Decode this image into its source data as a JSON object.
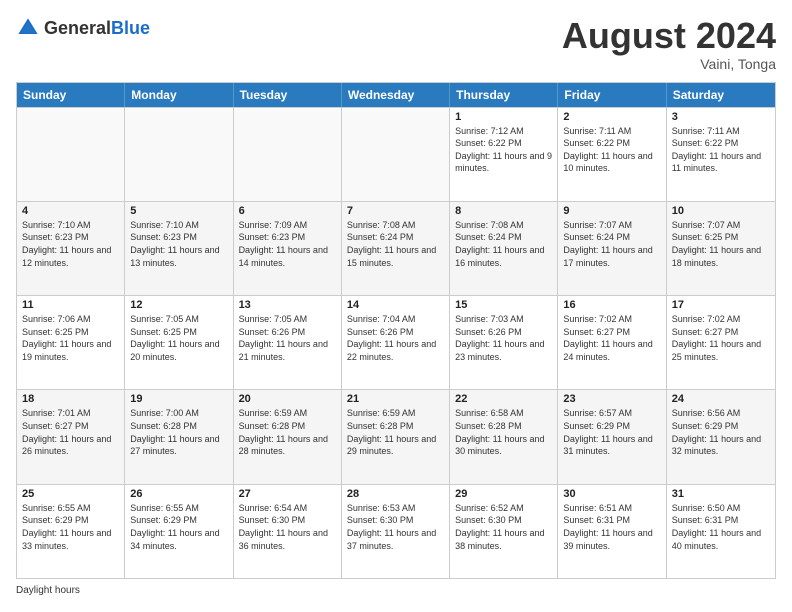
{
  "header": {
    "logo_general": "General",
    "logo_blue": "Blue",
    "month_title": "August 2024",
    "location": "Vaini, Tonga"
  },
  "days_of_week": [
    "Sunday",
    "Monday",
    "Tuesday",
    "Wednesday",
    "Thursday",
    "Friday",
    "Saturday"
  ],
  "footer": {
    "label": "Daylight hours"
  },
  "weeks": [
    [
      {
        "day": "",
        "sunrise": "",
        "sunset": "",
        "daylight": "",
        "empty": true
      },
      {
        "day": "",
        "sunrise": "",
        "sunset": "",
        "daylight": "",
        "empty": true
      },
      {
        "day": "",
        "sunrise": "",
        "sunset": "",
        "daylight": "",
        "empty": true
      },
      {
        "day": "",
        "sunrise": "",
        "sunset": "",
        "daylight": "",
        "empty": true
      },
      {
        "day": "1",
        "sunrise": "Sunrise: 7:12 AM",
        "sunset": "Sunset: 6:22 PM",
        "daylight": "Daylight: 11 hours and 9 minutes.",
        "empty": false
      },
      {
        "day": "2",
        "sunrise": "Sunrise: 7:11 AM",
        "sunset": "Sunset: 6:22 PM",
        "daylight": "Daylight: 11 hours and 10 minutes.",
        "empty": false
      },
      {
        "day": "3",
        "sunrise": "Sunrise: 7:11 AM",
        "sunset": "Sunset: 6:22 PM",
        "daylight": "Daylight: 11 hours and 11 minutes.",
        "empty": false
      }
    ],
    [
      {
        "day": "4",
        "sunrise": "Sunrise: 7:10 AM",
        "sunset": "Sunset: 6:23 PM",
        "daylight": "Daylight: 11 hours and 12 minutes.",
        "empty": false
      },
      {
        "day": "5",
        "sunrise": "Sunrise: 7:10 AM",
        "sunset": "Sunset: 6:23 PM",
        "daylight": "Daylight: 11 hours and 13 minutes.",
        "empty": false
      },
      {
        "day": "6",
        "sunrise": "Sunrise: 7:09 AM",
        "sunset": "Sunset: 6:23 PM",
        "daylight": "Daylight: 11 hours and 14 minutes.",
        "empty": false
      },
      {
        "day": "7",
        "sunrise": "Sunrise: 7:08 AM",
        "sunset": "Sunset: 6:24 PM",
        "daylight": "Daylight: 11 hours and 15 minutes.",
        "empty": false
      },
      {
        "day": "8",
        "sunrise": "Sunrise: 7:08 AM",
        "sunset": "Sunset: 6:24 PM",
        "daylight": "Daylight: 11 hours and 16 minutes.",
        "empty": false
      },
      {
        "day": "9",
        "sunrise": "Sunrise: 7:07 AM",
        "sunset": "Sunset: 6:24 PM",
        "daylight": "Daylight: 11 hours and 17 minutes.",
        "empty": false
      },
      {
        "day": "10",
        "sunrise": "Sunrise: 7:07 AM",
        "sunset": "Sunset: 6:25 PM",
        "daylight": "Daylight: 11 hours and 18 minutes.",
        "empty": false
      }
    ],
    [
      {
        "day": "11",
        "sunrise": "Sunrise: 7:06 AM",
        "sunset": "Sunset: 6:25 PM",
        "daylight": "Daylight: 11 hours and 19 minutes.",
        "empty": false
      },
      {
        "day": "12",
        "sunrise": "Sunrise: 7:05 AM",
        "sunset": "Sunset: 6:25 PM",
        "daylight": "Daylight: 11 hours and 20 minutes.",
        "empty": false
      },
      {
        "day": "13",
        "sunrise": "Sunrise: 7:05 AM",
        "sunset": "Sunset: 6:26 PM",
        "daylight": "Daylight: 11 hours and 21 minutes.",
        "empty": false
      },
      {
        "day": "14",
        "sunrise": "Sunrise: 7:04 AM",
        "sunset": "Sunset: 6:26 PM",
        "daylight": "Daylight: 11 hours and 22 minutes.",
        "empty": false
      },
      {
        "day": "15",
        "sunrise": "Sunrise: 7:03 AM",
        "sunset": "Sunset: 6:26 PM",
        "daylight": "Daylight: 11 hours and 23 minutes.",
        "empty": false
      },
      {
        "day": "16",
        "sunrise": "Sunrise: 7:02 AM",
        "sunset": "Sunset: 6:27 PM",
        "daylight": "Daylight: 11 hours and 24 minutes.",
        "empty": false
      },
      {
        "day": "17",
        "sunrise": "Sunrise: 7:02 AM",
        "sunset": "Sunset: 6:27 PM",
        "daylight": "Daylight: 11 hours and 25 minutes.",
        "empty": false
      }
    ],
    [
      {
        "day": "18",
        "sunrise": "Sunrise: 7:01 AM",
        "sunset": "Sunset: 6:27 PM",
        "daylight": "Daylight: 11 hours and 26 minutes.",
        "empty": false
      },
      {
        "day": "19",
        "sunrise": "Sunrise: 7:00 AM",
        "sunset": "Sunset: 6:28 PM",
        "daylight": "Daylight: 11 hours and 27 minutes.",
        "empty": false
      },
      {
        "day": "20",
        "sunrise": "Sunrise: 6:59 AM",
        "sunset": "Sunset: 6:28 PM",
        "daylight": "Daylight: 11 hours and 28 minutes.",
        "empty": false
      },
      {
        "day": "21",
        "sunrise": "Sunrise: 6:59 AM",
        "sunset": "Sunset: 6:28 PM",
        "daylight": "Daylight: 11 hours and 29 minutes.",
        "empty": false
      },
      {
        "day": "22",
        "sunrise": "Sunrise: 6:58 AM",
        "sunset": "Sunset: 6:28 PM",
        "daylight": "Daylight: 11 hours and 30 minutes.",
        "empty": false
      },
      {
        "day": "23",
        "sunrise": "Sunrise: 6:57 AM",
        "sunset": "Sunset: 6:29 PM",
        "daylight": "Daylight: 11 hours and 31 minutes.",
        "empty": false
      },
      {
        "day": "24",
        "sunrise": "Sunrise: 6:56 AM",
        "sunset": "Sunset: 6:29 PM",
        "daylight": "Daylight: 11 hours and 32 minutes.",
        "empty": false
      }
    ],
    [
      {
        "day": "25",
        "sunrise": "Sunrise: 6:55 AM",
        "sunset": "Sunset: 6:29 PM",
        "daylight": "Daylight: 11 hours and 33 minutes.",
        "empty": false
      },
      {
        "day": "26",
        "sunrise": "Sunrise: 6:55 AM",
        "sunset": "Sunset: 6:29 PM",
        "daylight": "Daylight: 11 hours and 34 minutes.",
        "empty": false
      },
      {
        "day": "27",
        "sunrise": "Sunrise: 6:54 AM",
        "sunset": "Sunset: 6:30 PM",
        "daylight": "Daylight: 11 hours and 36 minutes.",
        "empty": false
      },
      {
        "day": "28",
        "sunrise": "Sunrise: 6:53 AM",
        "sunset": "Sunset: 6:30 PM",
        "daylight": "Daylight: 11 hours and 37 minutes.",
        "empty": false
      },
      {
        "day": "29",
        "sunrise": "Sunrise: 6:52 AM",
        "sunset": "Sunset: 6:30 PM",
        "daylight": "Daylight: 11 hours and 38 minutes.",
        "empty": false
      },
      {
        "day": "30",
        "sunrise": "Sunrise: 6:51 AM",
        "sunset": "Sunset: 6:31 PM",
        "daylight": "Daylight: 11 hours and 39 minutes.",
        "empty": false
      },
      {
        "day": "31",
        "sunrise": "Sunrise: 6:50 AM",
        "sunset": "Sunset: 6:31 PM",
        "daylight": "Daylight: 11 hours and 40 minutes.",
        "empty": false
      }
    ]
  ]
}
